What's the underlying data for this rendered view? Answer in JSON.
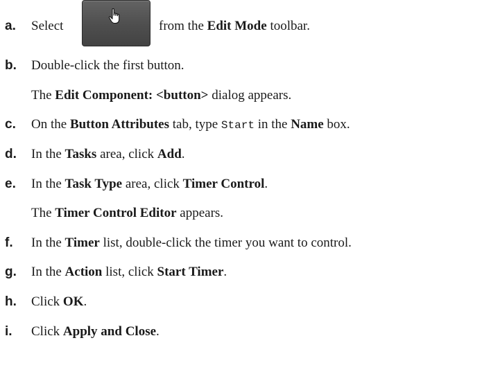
{
  "steps": [
    {
      "letter": "a.",
      "t1": "Select",
      "t2": "from the",
      "b1": "Edit Mode",
      "t3": "toolbar.",
      "icon": "hand-pointer-icon"
    },
    {
      "letter": "b.",
      "t1": "Double-click the first button."
    },
    {
      "t1": "The",
      "b1": "Edit Component: <button>",
      "t2": "dialog appears."
    },
    {
      "letter": "c.",
      "t1": "On the",
      "b1": "Button Attributes",
      "t2": "tab, type",
      "m1": "Start",
      "t3": "in the",
      "b2": "Name",
      "t4": "box."
    },
    {
      "letter": "d.",
      "t1": "In the",
      "b1": "Tasks",
      "t2": "area, click",
      "b2": "Add",
      "t3": "."
    },
    {
      "letter": "e.",
      "t1": "In the",
      "b1": "Task Type",
      "t2": "area, click",
      "b2": "Timer Control",
      "t3": "."
    },
    {
      "t1": "The",
      "b1": "Timer Control Editor",
      "t2": "appears."
    },
    {
      "letter": "f.",
      "t1": "In the",
      "b1": "Timer",
      "t2": "list, double-click the timer you want to control."
    },
    {
      "letter": "g.",
      "t1": "In the",
      "b1": "Action",
      "t2": "list, click",
      "b2": "Start Timer",
      "t3": "."
    },
    {
      "letter": "h.",
      "t1": "Click",
      "b1": "OK",
      "t2": "."
    },
    {
      "letter": "i.",
      "t1": "Click",
      "b1": "Apply and Close",
      "t2": "."
    }
  ]
}
